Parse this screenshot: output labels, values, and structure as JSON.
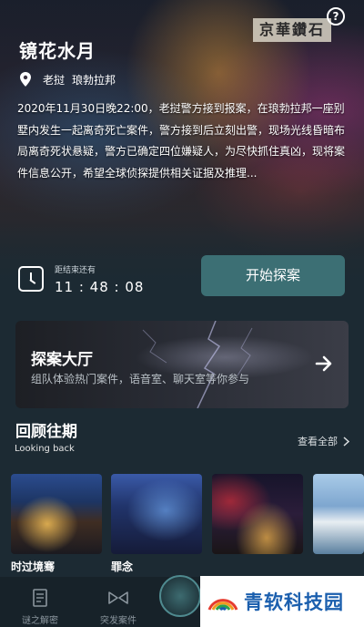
{
  "hero": {
    "building_sign": "京華鑽石",
    "title": "镜花水月",
    "location": [
      "老挝",
      "琅勃拉邦"
    ],
    "description": "2020年11月30日晚22:00，老挝警方接到报案，在琅勃拉邦一座别墅内发生一起离奇死亡案件，警方接到后立刻出警，现场光线昏暗布局离奇死状悬疑，警方已确定四位嫌疑人，为尽快抓住真凶，现将案件信息公开，希望全球侦探提供相关证据及推理...",
    "timer_label": "距结束还有",
    "timer_value": "11 : 48 : 08",
    "start_button": "开始探案",
    "help": "?"
  },
  "hall": {
    "title": "探案大厅",
    "subtitle": "组队体验热门案件，语音室、聊天室等你参与"
  },
  "review": {
    "title": "回顾往期",
    "subtitle": "Looking back",
    "view_all": "查看全部",
    "items": [
      {
        "caption": "时过境骞"
      },
      {
        "caption": "罪念"
      }
    ]
  },
  "tabs": [
    {
      "label": "谜之解密",
      "icon": "document-icon"
    },
    {
      "label": "突发案件",
      "icon": "bowtie-icon"
    }
  ],
  "watermark": {
    "text": "青软科技园"
  }
}
